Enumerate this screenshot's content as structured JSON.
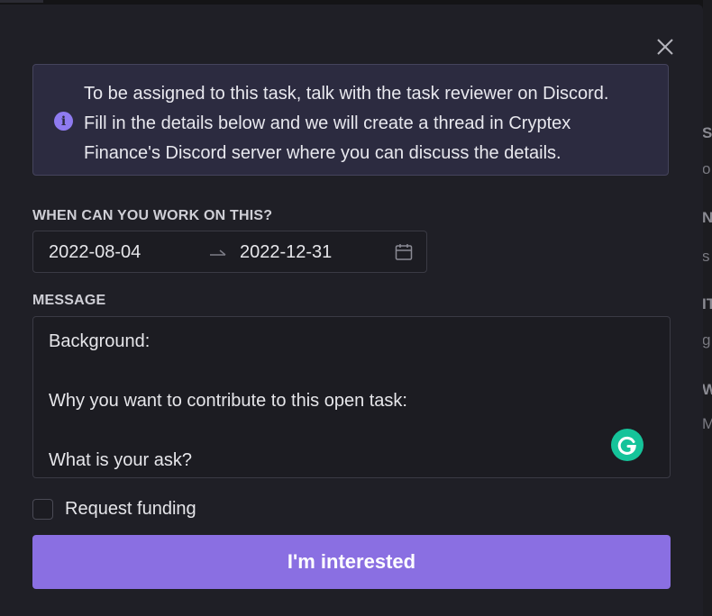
{
  "info": {
    "lines": [
      "To be assigned to this task, talk with the task reviewer on Discord.",
      "Fill in the details below and we will create a thread in Cryptex",
      "Finance's Discord server where you can discuss the details."
    ],
    "icon": "info-icon"
  },
  "availability": {
    "label": "WHEN CAN YOU WORK ON THIS?",
    "start_date": "2022-08-04",
    "end_date": "2022-12-31"
  },
  "message": {
    "label": "MESSAGE",
    "lines": [
      "Background:",
      "",
      "Why you want to contribute to this open task:",
      "",
      "What is your ask?"
    ]
  },
  "funding": {
    "label": "Request funding",
    "checked": false
  },
  "submit_label": "I'm interested",
  "background_fragments": [
    "S",
    "o",
    "N",
    "s",
    "IT",
    "g",
    "W",
    "M"
  ],
  "colors": {
    "accent": "#8a6fe2",
    "info_icon": "#8f7bf0",
    "grammarly": "#15c39a"
  }
}
